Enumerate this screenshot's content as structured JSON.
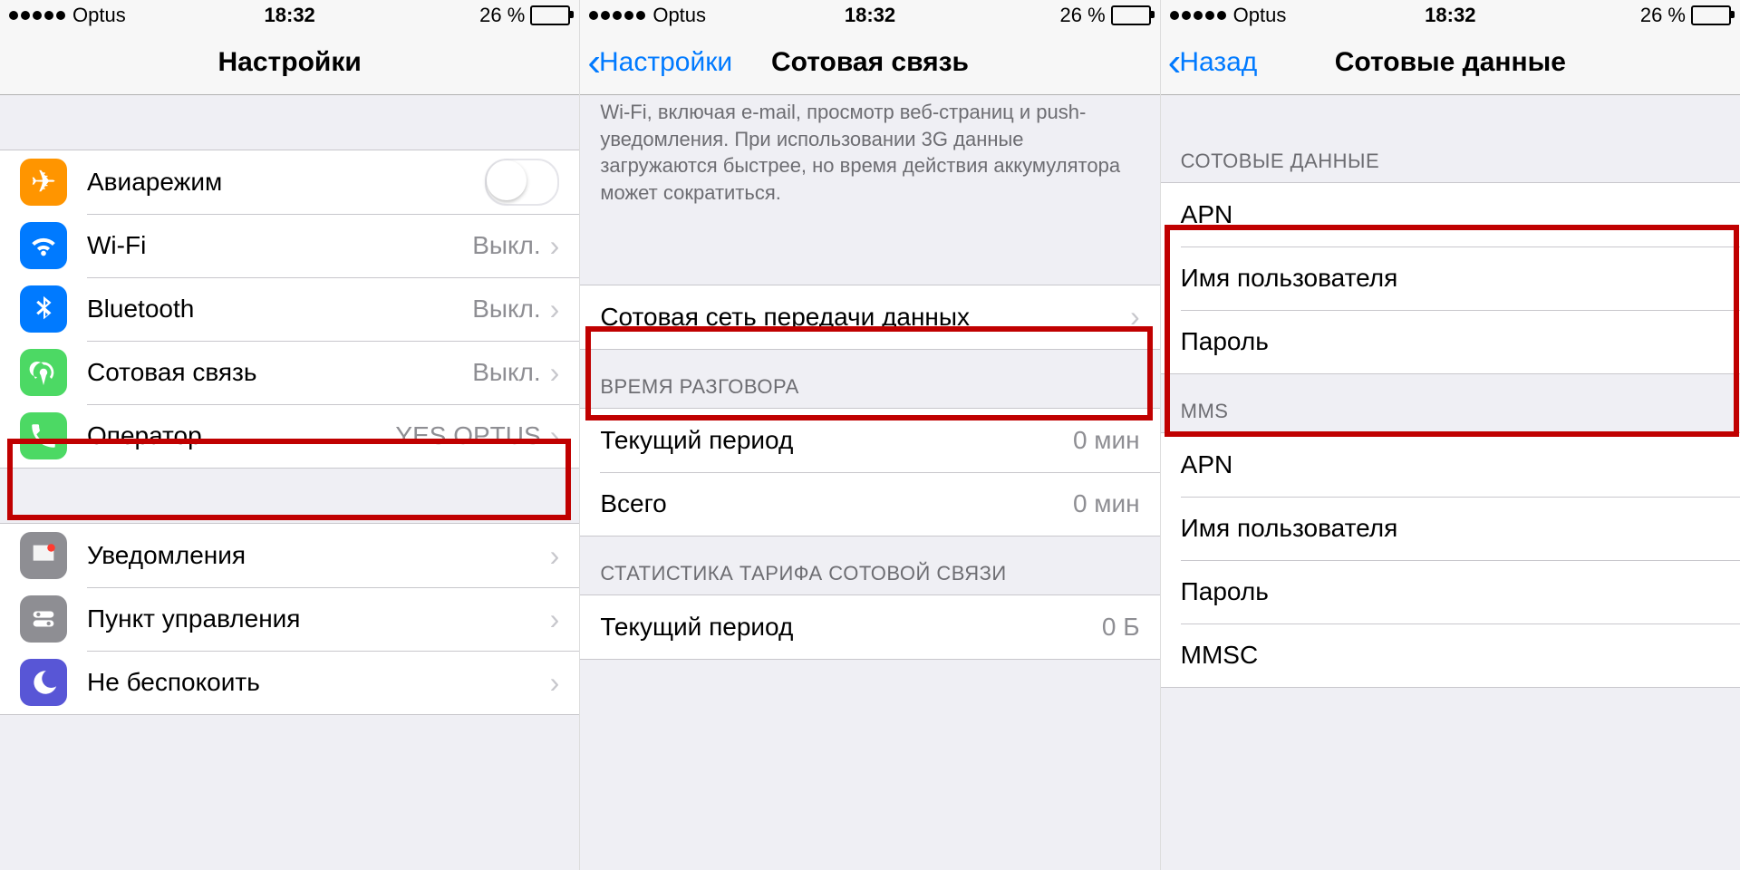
{
  "status": {
    "carrier": "Optus",
    "time": "18:32",
    "battery_pct": "26 %"
  },
  "screen1": {
    "title": "Настройки",
    "rows1": [
      {
        "label": "Авиарежим"
      },
      {
        "label": "Wi-Fi",
        "value": "Выкл."
      },
      {
        "label": "Bluetooth",
        "value": "Выкл."
      },
      {
        "label": "Сотовая связь",
        "value": "Выкл."
      },
      {
        "label": "Оператор",
        "value": "YES OPTUS"
      }
    ],
    "rows2": [
      {
        "label": "Уведомления"
      },
      {
        "label": "Пункт управления"
      },
      {
        "label": "Не беспокоить"
      }
    ]
  },
  "screen2": {
    "back": "Настройки",
    "title": "Сотовая связь",
    "footer_text": "Wi-Fi, включая e-mail, просмотр веб-страниц и push-уведомления. При использовании 3G данные загружаются быстрее, но время действия аккумулятора может сократиться.",
    "row_network": "Сотовая сеть передачи данных",
    "talk_header": "ВРЕМЯ РАЗГОВОРА",
    "talk_current_label": "Текущий период",
    "talk_current_value": "0 мин",
    "talk_total_label": "Всего",
    "talk_total_value": "0 мин",
    "stats_header": "СТАТИСТИКА ТАРИФА СОТОВОЙ СВЯЗИ",
    "stats_current_label": "Текущий период",
    "stats_current_value": "0 Б"
  },
  "screen3": {
    "back": "Назад",
    "title": "Сотовые данные",
    "sec1_header": "СОТОВЫЕ ДАННЫЕ",
    "sec1_rows": [
      "APN",
      "Имя пользователя",
      "Пароль"
    ],
    "sec2_header": "MMS",
    "sec2_rows": [
      "APN",
      "Имя пользователя",
      "Пароль",
      "MMSC"
    ]
  }
}
